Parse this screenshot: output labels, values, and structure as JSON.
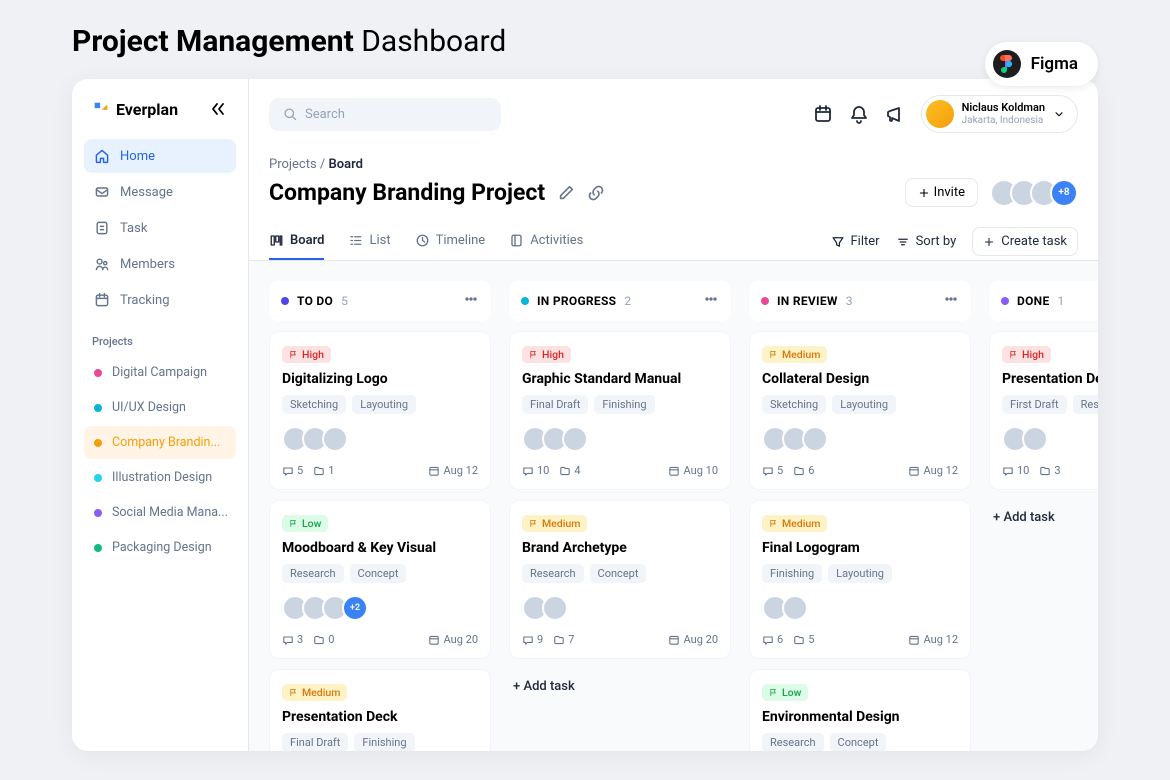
{
  "page_title_bold": "Project Management",
  "page_title_light": " Dashboard",
  "figma_label": "Figma",
  "brand": "Everplan",
  "search_placeholder": "Search",
  "user": {
    "name": "Niclaus Koldman",
    "location": "Jakarta, Indonesia"
  },
  "nav": [
    {
      "icon": "home",
      "label": "Home",
      "active": true
    },
    {
      "icon": "message",
      "label": "Message"
    },
    {
      "icon": "task",
      "label": "Task"
    },
    {
      "icon": "members",
      "label": "Members"
    },
    {
      "icon": "tracking",
      "label": "Tracking"
    }
  ],
  "projects_label": "Projects",
  "projects": [
    {
      "color": "#ec4899",
      "label": "Digital Campaign"
    },
    {
      "color": "#06b6d4",
      "label": "UI/UX Design"
    },
    {
      "color": "#f59e0b",
      "label": "Company Brandin...",
      "active": true
    },
    {
      "color": "#22d3ee",
      "label": "Illustration Design"
    },
    {
      "color": "#8b5cf6",
      "label": "Social Media Mana..."
    },
    {
      "color": "#10b981",
      "label": "Packaging Design"
    }
  ],
  "breadcrumb": {
    "parent": "Projects",
    "current": "Board"
  },
  "project_title": "Company Branding Project",
  "invite_label": "Invite",
  "avatars_more": "+8",
  "tabs": [
    {
      "label": "Board",
      "active": true
    },
    {
      "label": "List"
    },
    {
      "label": "Timeline"
    },
    {
      "label": "Activities"
    }
  ],
  "actions": {
    "filter": "Filter",
    "sort": "Sort by",
    "create": "Create task"
  },
  "add_task_label": "Add task",
  "columns": [
    {
      "color": "#4f46e5",
      "title": "TO DO",
      "count": "5",
      "cards": [
        {
          "priority": "High",
          "title": "Digitalizing Logo",
          "tags": [
            "Sketching",
            "Layouting"
          ],
          "avatars": 3,
          "more": "",
          "comments": "5",
          "files": "1",
          "date": "Aug 12"
        },
        {
          "priority": "Low",
          "title": "Moodboard & Key Visual",
          "tags": [
            "Research",
            "Concept"
          ],
          "avatars": 3,
          "more": "+2",
          "comments": "3",
          "files": "0",
          "date": "Aug 20"
        },
        {
          "priority": "Medium",
          "title": "Presentation Deck",
          "tags": [
            "Final Draft",
            "Finishing"
          ],
          "avatars": 0,
          "more": "",
          "comments": "",
          "files": "",
          "date": ""
        }
      ]
    },
    {
      "color": "#06b6d4",
      "title": "IN PROGRESS",
      "count": "2",
      "cards": [
        {
          "priority": "High",
          "title": "Graphic Standard Manual",
          "tags": [
            "Final Draft",
            "Finishing"
          ],
          "avatars": 3,
          "more": "",
          "comments": "10",
          "files": "4",
          "date": "Aug 10"
        },
        {
          "priority": "Medium",
          "title": "Brand Archetype",
          "tags": [
            "Research",
            "Concept"
          ],
          "avatars": 2,
          "more": "",
          "comments": "9",
          "files": "7",
          "date": "Aug 20"
        }
      ],
      "add": true
    },
    {
      "color": "#ec4899",
      "title": "IN REVIEW",
      "count": "3",
      "cards": [
        {
          "priority": "Medium",
          "title": "Collateral Design",
          "tags": [
            "Sketching",
            "Layouting"
          ],
          "avatars": 3,
          "more": "",
          "comments": "5",
          "files": "6",
          "date": "Aug 12"
        },
        {
          "priority": "Medium",
          "title": "Final Logogram",
          "tags": [
            "Finishing",
            "Layouting"
          ],
          "avatars": 2,
          "more": "",
          "comments": "6",
          "files": "5",
          "date": "Aug 12"
        },
        {
          "priority": "Low",
          "title": "Environmental Design",
          "tags": [
            "Research",
            "Concept"
          ],
          "avatars": 0,
          "more": "",
          "comments": "",
          "files": "",
          "date": ""
        }
      ]
    },
    {
      "color": "#8b5cf6",
      "title": "DONE",
      "count": "1",
      "cards": [
        {
          "priority": "High",
          "title": "Presentation Deck",
          "tags": [
            "First Draft",
            "Research"
          ],
          "avatars": 2,
          "more": "",
          "comments": "10",
          "files": "3",
          "date": ""
        }
      ],
      "add": true
    }
  ]
}
